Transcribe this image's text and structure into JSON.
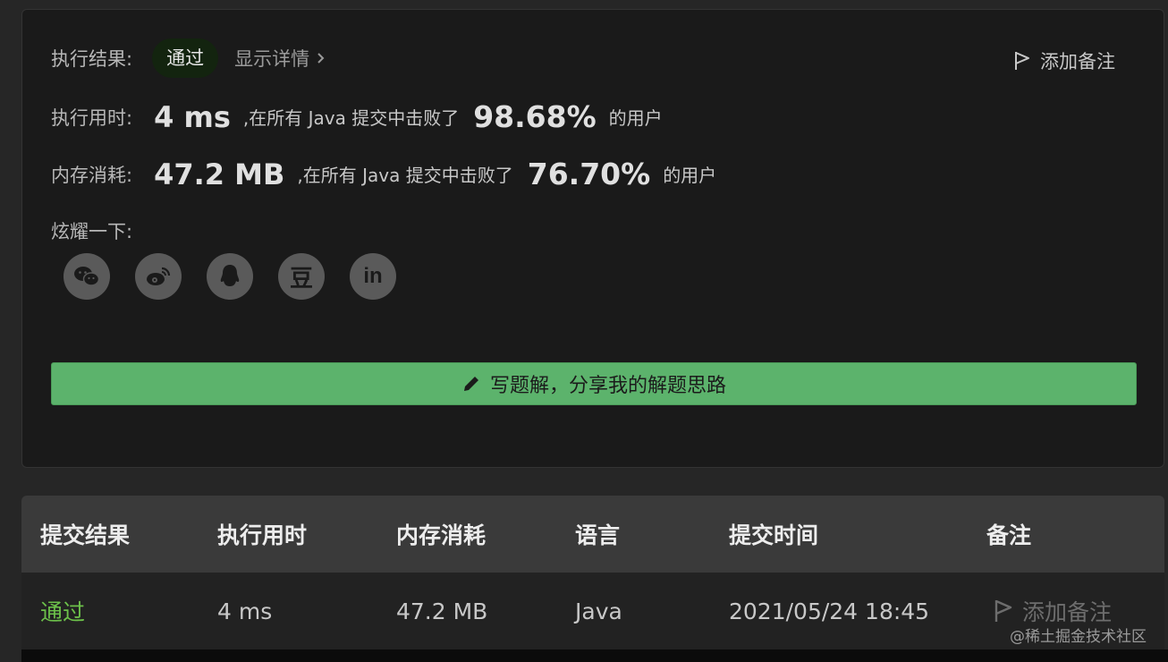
{
  "result_card": {
    "result_label": "执行结果:",
    "result_status": "通过",
    "detail_link": "显示详情",
    "add_note": "添加备注",
    "runtime_label": "执行用时:",
    "runtime_value": "4 ms",
    "runtime_mid": ",在所有 Java 提交中击败了",
    "runtime_percent": "98.68%",
    "runtime_tail": "的用户",
    "memory_label": "内存消耗:",
    "memory_value": "47.2 MB",
    "memory_mid": ",在所有 Java 提交中击败了",
    "memory_percent": "76.70%",
    "memory_tail": "的用户",
    "share_label": "炫耀一下:",
    "share_icons": [
      "wechat-icon",
      "weibo-icon",
      "qq-icon",
      "douban-icon",
      "linkedin-icon"
    ],
    "douban_glyph": "豆",
    "linkedin_glyph": "in",
    "write_solution": "写题解，分享我的解题思路"
  },
  "submissions_table": {
    "headers": [
      "提交结果",
      "执行用时",
      "内存消耗",
      "语言",
      "提交时间",
      "备注"
    ],
    "rows": [
      {
        "status": "通过",
        "runtime": "4 ms",
        "memory": "47.2 MB",
        "language": "Java",
        "time": "2021/05/24 18:45",
        "note": "添加备注"
      }
    ]
  },
  "watermark": "@稀土掘金技术社区",
  "colors": {
    "accent_green": "#5cb36c",
    "pass_green": "#6cc04a",
    "background": "#262626",
    "card": "#1a1a1a"
  }
}
